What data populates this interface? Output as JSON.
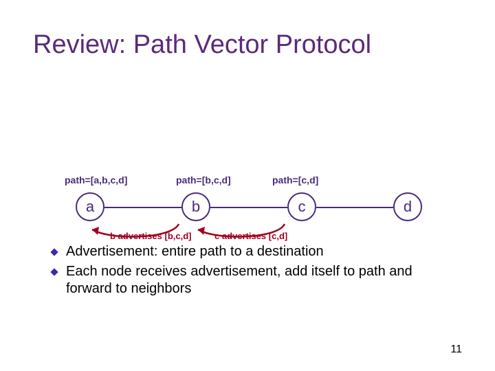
{
  "title": "Review: Path Vector Protocol",
  "diagram": {
    "nodes": [
      "a",
      "b",
      "c",
      "d"
    ],
    "path_labels": [
      "path=[a,b,c,d]",
      "path=[b,c,d]",
      "path=[c,d]"
    ],
    "ad_labels": [
      "b advertises [b,c,d]",
      "c advertises [c,d]"
    ]
  },
  "bullets": [
    "Advertisement: entire path to a destination",
    "Each node receives advertisement, add itself to path and forward to neighbors"
  ],
  "slide_number": "11"
}
